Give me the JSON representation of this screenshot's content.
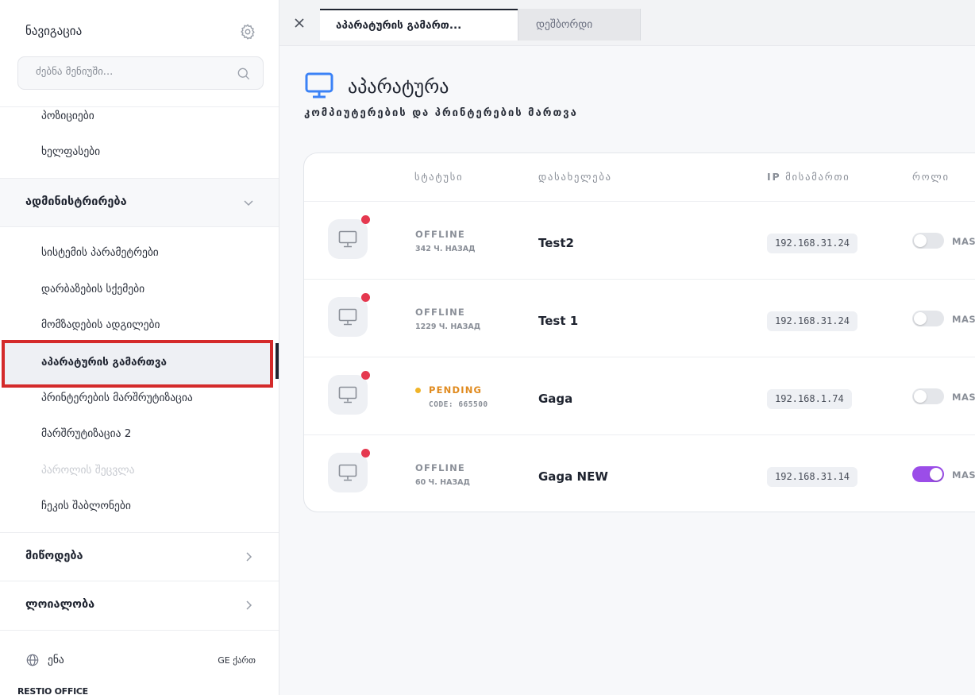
{
  "sidebar": {
    "title": "ნავიგაცია",
    "search_placeholder": "ძებნა მენიუში...",
    "top_items": [
      "პოზიციები",
      "ხელფასები"
    ],
    "admin_group": {
      "label": "ადმინისტრირება",
      "items": [
        "სისტემის პარამეტრები",
        "დარბაზების სქემები",
        "მომზადების ადგილები",
        "აპარატურის გამართვა",
        "პრინტერების მარშრუტიზაცია",
        "მარშრუტიზაცია 2",
        "პაროლის შეცვლა",
        "ჩეკის შაბლონები"
      ]
    },
    "groups": [
      {
        "label": "მიწოდება"
      },
      {
        "label": "ლოიალობა"
      }
    ],
    "language": {
      "label": "ენა",
      "value": "GE ქართ"
    },
    "brand": "RESTIO OFFICE"
  },
  "tabs": [
    {
      "label": "აპარატურის გამართ...",
      "active": true
    },
    {
      "label": "დეშბორდი",
      "active": false
    }
  ],
  "page": {
    "title": "აპარატურა",
    "subtitle": "კომპიუტერების და პრინტერების მართვა"
  },
  "table": {
    "headers": {
      "status": "სტატუსი",
      "name": "დასახელება",
      "ip_prefix": "IP",
      "ip_rest": " მისამართი",
      "role": "როლი"
    },
    "rows": [
      {
        "status": "OFFLINE",
        "sub": "342 Ч. НАЗАД",
        "name": "Test2",
        "ip": "192.168.31.24",
        "role": "MAST",
        "toggle_on": false
      },
      {
        "status": "OFFLINE",
        "sub": "1229 Ч. НАЗАД",
        "name": "Test 1",
        "ip": "192.168.31.24",
        "role": "MAST",
        "toggle_on": false
      },
      {
        "status": "PENDING",
        "sub": "CODE: 665500",
        "name": "Gaga",
        "ip": "192.168.1.74",
        "role": "MAST",
        "toggle_on": false
      },
      {
        "status": "OFFLINE",
        "sub": "60 Ч. НАЗАД",
        "name": "Gaga NEW",
        "ip": "192.168.31.14",
        "role": "MAST",
        "toggle_on": true
      }
    ]
  },
  "colors": {
    "accent": "#9b4de8",
    "page_icon": "#3b82f6",
    "offline_dot": "#e5384f",
    "pending": "#e08a1e",
    "highlight_box": "#d42a2a"
  },
  "icons": [
    "gear-icon",
    "search-icon",
    "chevron-down-icon",
    "chevron-right-icon",
    "globe-icon",
    "close-icon",
    "monitor-icon"
  ]
}
